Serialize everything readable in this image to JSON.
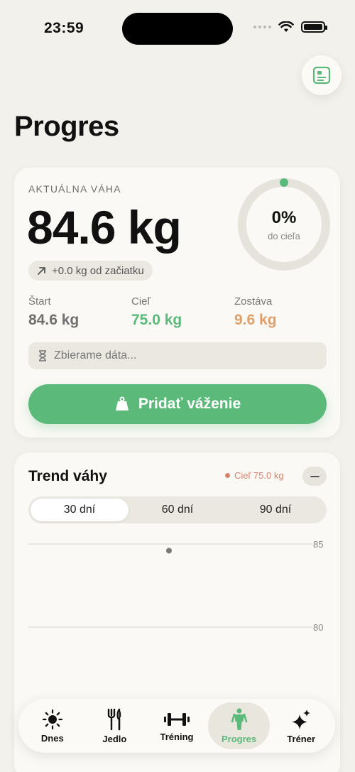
{
  "status": {
    "time": "23:59"
  },
  "page": {
    "title": "Progres"
  },
  "weight_card": {
    "label": "AKTUÁLNA VÁHA",
    "current": "84.6 kg",
    "goal_progress": 0,
    "goal_percent": "0%",
    "goal_sub": "do cieľa",
    "change": "+0.0 kg od začiatku",
    "start_label": "Štart",
    "start_value": "84.6 kg",
    "goal_label": "Cieľ",
    "goal_value": "75.0 kg",
    "remaining_label": "Zostáva",
    "remaining_value": "9.6 kg",
    "info": "Zbierame dáta...",
    "add_button": "Pridať váženie"
  },
  "trend": {
    "title": "Trend váhy",
    "goal_legend": "Cieľ 75.0 kg",
    "ranges": [
      "30 dní",
      "60 dní",
      "90 dní"
    ],
    "active_range": "30 dní"
  },
  "chart_data": {
    "type": "scatter",
    "title": "Trend váhy",
    "y_ticks": [
      85,
      80
    ],
    "ylim": [
      75,
      86
    ],
    "points": [
      {
        "y": 84.6
      }
    ],
    "goal": 75.0
  },
  "colors": {
    "accent": "#5bb97a",
    "goal": "#d9826c",
    "remaining": "#e0a06a"
  },
  "tabs": [
    {
      "label": "Dnes",
      "icon": "sun-icon"
    },
    {
      "label": "Jedlo",
      "icon": "fork-knife-icon"
    },
    {
      "label": "Tréning",
      "icon": "dumbbell-icon"
    },
    {
      "label": "Progres",
      "icon": "figure-icon",
      "active": true
    },
    {
      "label": "Tréner",
      "icon": "sparkles-icon"
    }
  ]
}
